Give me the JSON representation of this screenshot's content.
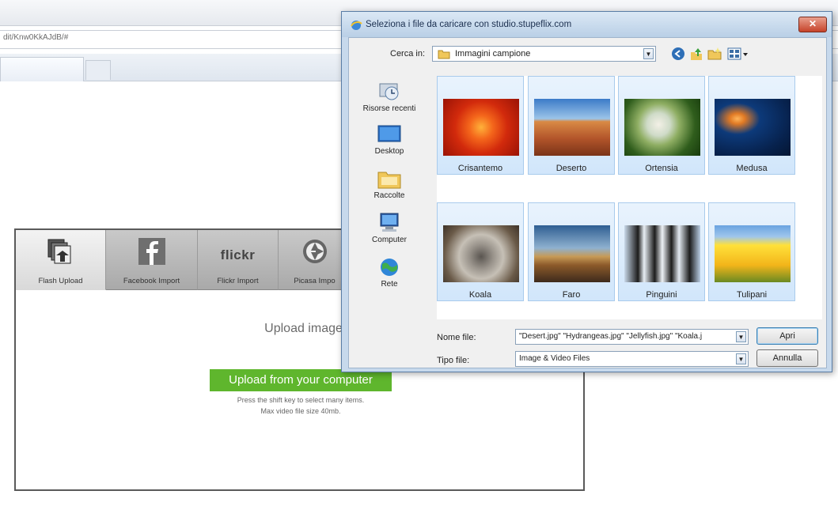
{
  "browser": {
    "address": "dit/Knw0KkAJdB/#"
  },
  "uploader": {
    "tabs": [
      {
        "label": "Flash Upload",
        "icon": "flash-upload-icon"
      },
      {
        "label": "Facebook Import",
        "icon": "facebook-icon"
      },
      {
        "label": "Flickr Import",
        "icon": "flickr-logo",
        "logo_text": "flickr"
      },
      {
        "label": "Picasa Impo",
        "icon": "picasa-icon"
      }
    ],
    "heading": "Upload images and videos fro",
    "upload_button": "Upload from your computer",
    "hint_line1": "Press the shift key to select many items.",
    "hint_line2": "Max video file size 40mb."
  },
  "dialog": {
    "title": "Seleziona i file da caricare con studio.stupeflix.com",
    "close_label": "✕",
    "look_in_label": "Cerca in:",
    "look_in_value": "Immagini campione",
    "places": [
      {
        "label": "Risorse recenti",
        "icon": "recent-places-icon"
      },
      {
        "label": "Desktop",
        "icon": "desktop-icon"
      },
      {
        "label": "Raccolte",
        "icon": "libraries-icon"
      },
      {
        "label": "Computer",
        "icon": "computer-icon"
      },
      {
        "label": "Rete",
        "icon": "network-icon"
      }
    ],
    "files": [
      {
        "name": "Crisantemo"
      },
      {
        "name": "Deserto"
      },
      {
        "name": "Ortensia"
      },
      {
        "name": "Medusa"
      },
      {
        "name": "Koala"
      },
      {
        "name": "Faro"
      },
      {
        "name": "Pinguini"
      },
      {
        "name": "Tulipani"
      }
    ],
    "file_name_label": "Nome file:",
    "file_name_value": "\"Desert.jpg\" \"Hydrangeas.jpg\" \"Jellyfish.jpg\" \"Koala.j",
    "file_type_label": "Tipo file:",
    "file_type_value": "Image & Video Files",
    "open_button": "Apri",
    "cancel_button": "Annulla"
  },
  "colors": {
    "upload_button": "#5fb62d",
    "dialog_frame": "#c7d9ec",
    "close_button": "#c6432a"
  }
}
